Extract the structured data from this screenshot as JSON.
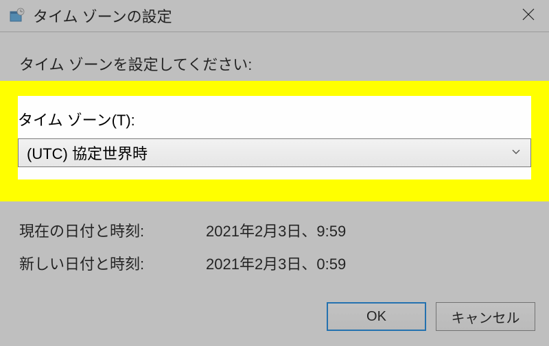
{
  "window": {
    "title": "タイム ゾーンの設定",
    "instruction": "タイム ゾーンを設定してください:"
  },
  "timezone": {
    "label": "タイム ゾーン(T):",
    "selected": "(UTC) 協定世界時"
  },
  "datetime": {
    "current_label": "現在の日付と時刻:",
    "current_value": "2021年2月3日、9:59",
    "new_label": "新しい日付と時刻:",
    "new_value": "2021年2月3日、0:59"
  },
  "buttons": {
    "ok": "OK",
    "cancel": "キャンセル"
  }
}
